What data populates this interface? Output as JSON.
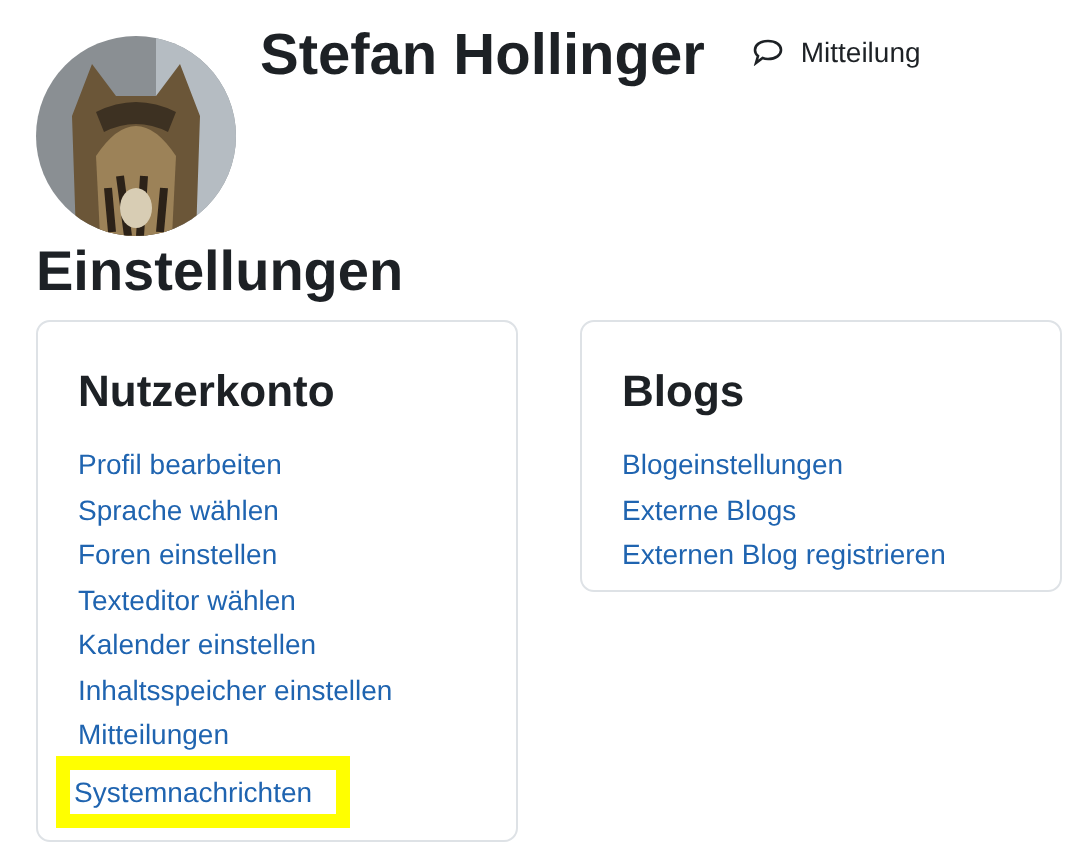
{
  "profile": {
    "name": "Stefan Hollinger",
    "message_link": "Mitteilung"
  },
  "heading": "Einstellungen",
  "cards": [
    {
      "title": "Nutzerkonto",
      "links": [
        {
          "label": "Profil bearbeiten",
          "highlighted": false
        },
        {
          "label": "Sprache wählen",
          "highlighted": false
        },
        {
          "label": "Foren einstellen",
          "highlighted": false
        },
        {
          "label": "Texteditor wählen",
          "highlighted": false
        },
        {
          "label": "Kalender einstellen",
          "highlighted": false
        },
        {
          "label": "Inhaltsspeicher einstellen",
          "highlighted": false
        },
        {
          "label": "Mitteilungen",
          "highlighted": false
        },
        {
          "label": "Systemnachrichten",
          "highlighted": true
        }
      ]
    },
    {
      "title": "Blogs",
      "links": [
        {
          "label": "Blogeinstellungen",
          "highlighted": false
        },
        {
          "label": "Externe Blogs",
          "highlighted": false
        },
        {
          "label": "Externen Blog registrieren",
          "highlighted": false
        }
      ]
    }
  ]
}
